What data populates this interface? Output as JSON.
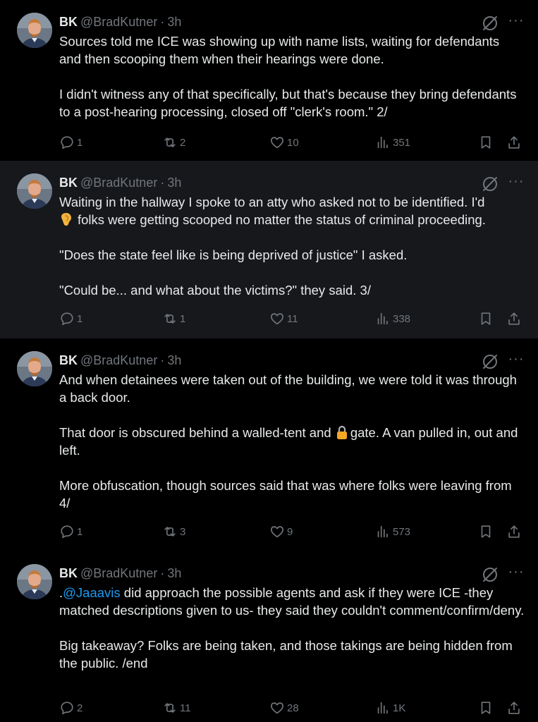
{
  "tweets": [
    {
      "name": "BK",
      "handle": "@BradKutner",
      "time": "3h",
      "paragraphs": [
        "Sources told me ICE was showing up with name lists, waiting for defendants and then scooping them when their hearings were done.",
        "I didn't witness any of that specifically, but that's because they bring defendants to a post-hearing processing, closed off \"clerk's room.\" 2/"
      ],
      "replies": "1",
      "reposts": "2",
      "likes": "10",
      "views": "351"
    },
    {
      "name": "BK",
      "handle": "@BradKutner",
      "time": "3h",
      "p1_before": "Waiting in the hallway I spoke to an atty who asked not to be identified. I'd",
      "p1_after": "folks were getting scooped no matter the status of criminal proceeding.",
      "p1_emoji": "ear-emoji",
      "paragraphs": [
        "\"Does the state feel like is being deprived of justice\" I asked.",
        "\"Could be... and what about the victims?\" they said. 3/"
      ],
      "replies": "1",
      "reposts": "1",
      "likes": "11",
      "views": "338"
    },
    {
      "name": "BK",
      "handle": "@BradKutner",
      "time": "3h",
      "p1": "And when detainees were taken out of the building, we were told it was through a back door.",
      "p2_before": "That door is obscured behind a walled-tent and",
      "p2_after": "gate. A van pulled in, out and left.",
      "p2_emoji": "lock-emoji",
      "p3": "More obfuscation, though sources said that was where folks were leaving from 4/",
      "replies": "1",
      "reposts": "3",
      "likes": "9",
      "views": "573"
    },
    {
      "name": "BK",
      "handle": "@BradKutner",
      "time": "3h",
      "p1_prefix": ".",
      "p1_mention": "@Jaaavis",
      "p1_rest": " did approach the possible agents and ask if they were ICE -they matched descriptions given to us- they said they couldn't comment/confirm/deny.",
      "p2": "Big takeaway? Folks are being taken, and those takings are being hidden from the public. /end",
      "replies": "2",
      "reposts": "11",
      "likes": "28",
      "views": "1K"
    }
  ],
  "colors": {
    "text": "#e7e9ea",
    "muted": "#71767b",
    "link": "#1d9bf0",
    "highlight_bg": "#16181c",
    "thread_line": "#333639"
  },
  "icons": [
    "grok-icon",
    "more-icon",
    "reply-icon",
    "repost-icon",
    "like-icon",
    "views-icon",
    "bookmark-icon",
    "share-icon"
  ]
}
